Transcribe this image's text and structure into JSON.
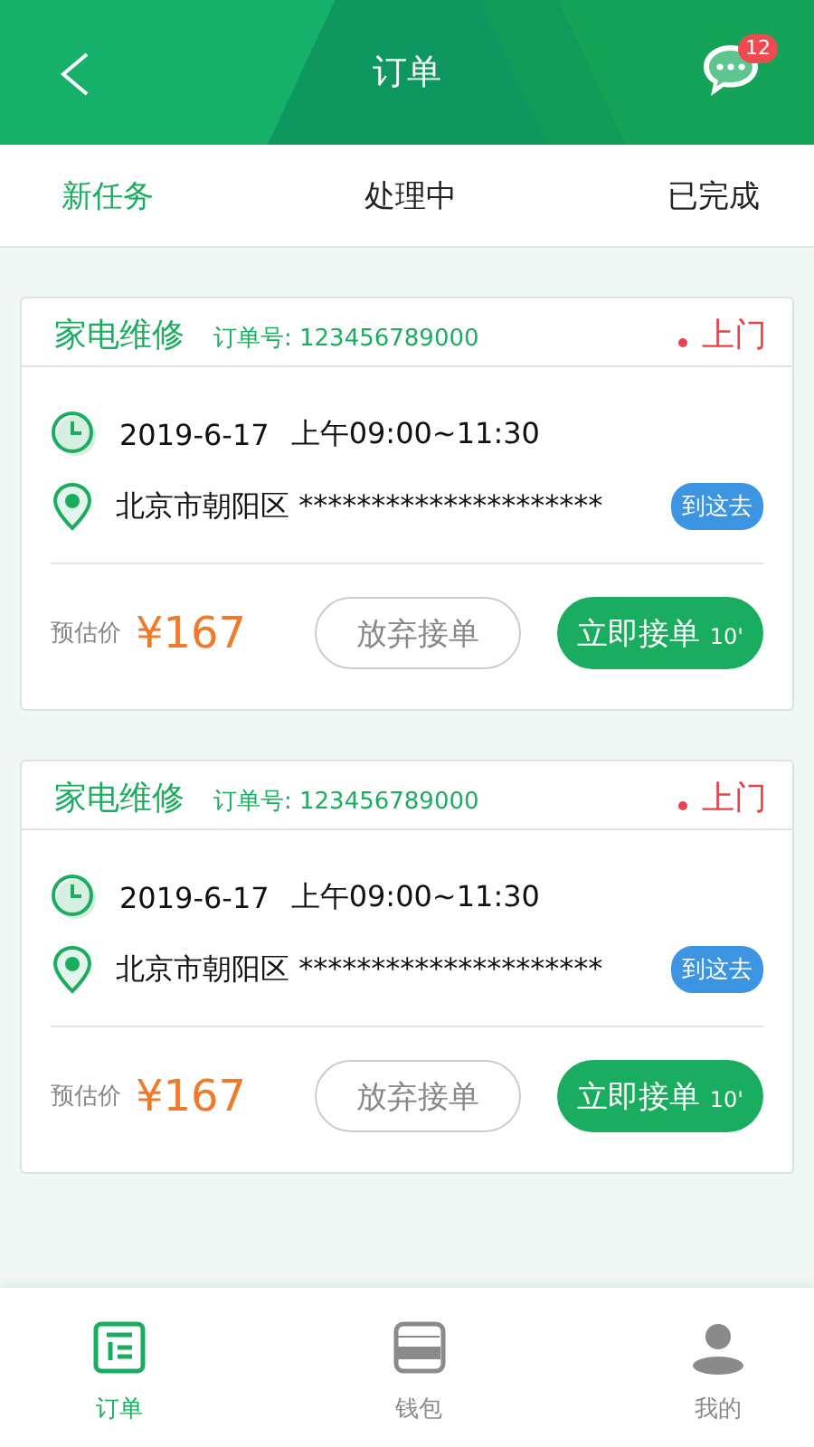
{
  "header": {
    "title": "订单",
    "badge": "12"
  },
  "tabs": [
    {
      "label": "新任务",
      "selected": true
    },
    {
      "label": "处理中",
      "selected": false
    },
    {
      "label": "已完成",
      "selected": false
    }
  ],
  "orders": [
    {
      "category": "家电维修",
      "order_no": "订单号: 123456789000",
      "service": "上门",
      "date": "2019-6-17",
      "time": "上午09:00~11:30",
      "address": "北京市朝阳区 *********************",
      "navigate": "到这去",
      "price_label": "预估价",
      "price": "¥167",
      "decline": "放弃接单",
      "accept": "立即接单",
      "countdown": "10'"
    },
    {
      "category": "家电维修",
      "order_no": "订单号: 123456789000",
      "service": "上门",
      "date": "2019-6-17",
      "time": "上午09:00~11:30",
      "address": "北京市朝阳区 *********************",
      "navigate": "到这去",
      "price_label": "预估价",
      "price": "¥167",
      "decline": "放弃接单",
      "accept": "立即接单",
      "countdown": "10'"
    }
  ],
  "nav": [
    {
      "kind": "orders",
      "label": "订单",
      "selected": true
    },
    {
      "kind": "wallet",
      "label": "钱包",
      "selected": false
    },
    {
      "kind": "profile",
      "label": "我的",
      "selected": false
    }
  ]
}
